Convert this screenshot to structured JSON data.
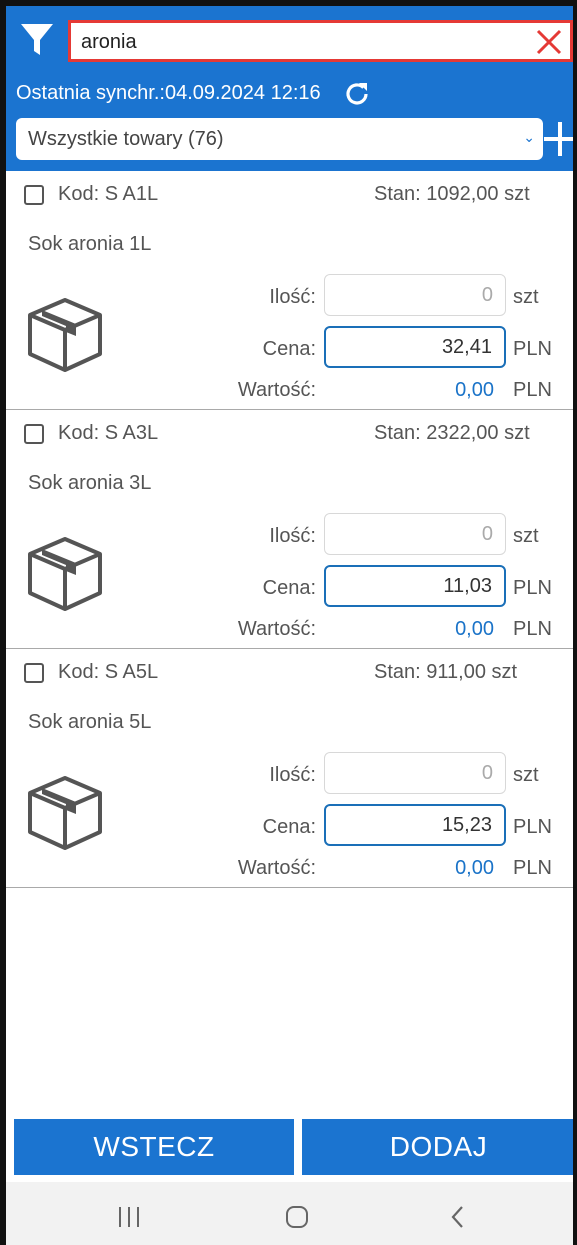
{
  "search": {
    "value": "aronia",
    "placeholder": ""
  },
  "sync": {
    "label": "Ostatnia synchr.:04.09.2024 12:16"
  },
  "category_select": {
    "selected": "Wszystkie towary (76)"
  },
  "products": [
    {
      "code": "Kod: S A1L",
      "stock": "Stan: 1092,00 szt",
      "name": "Sok aronia 1L",
      "qty_label": "Ilość:",
      "qty_value": "0",
      "qty_unit": "szt",
      "price_label": "Cena:",
      "price_value": "32,41",
      "price_unit": "PLN",
      "value_label": "Wartość:",
      "value_amount": "0,00",
      "value_unit": "PLN"
    },
    {
      "code": "Kod: S A3L",
      "stock": "Stan: 2322,00 szt",
      "name": "Sok aronia 3L",
      "qty_label": "Ilość:",
      "qty_value": "0",
      "qty_unit": "szt",
      "price_label": "Cena:",
      "price_value": "11,03",
      "price_unit": "PLN",
      "value_label": "Wartość:",
      "value_amount": "0,00",
      "value_unit": "PLN"
    },
    {
      "code": "Kod: S A5L",
      "stock": "Stan: 911,00 szt",
      "name": "Sok aronia 5L",
      "qty_label": "Ilość:",
      "qty_value": "0",
      "qty_unit": "szt",
      "price_label": "Cena:",
      "price_value": "15,23",
      "price_unit": "PLN",
      "value_label": "Wartość:",
      "value_amount": "0,00",
      "value_unit": "PLN"
    }
  ],
  "buttons": {
    "back": "WSTECZ",
    "add": "DODAJ"
  },
  "icons": {
    "filter": "filter-icon",
    "clear": "close-icon",
    "sync": "refresh-icon",
    "add": "plus-icon",
    "product": "box-icon",
    "nav_recents": "recent-apps-icon",
    "nav_home": "home-icon",
    "nav_back": "back-icon"
  },
  "colors": {
    "primary": "#1b74d0",
    "search_border": "#e53935",
    "value_text": "#1a73c8"
  }
}
